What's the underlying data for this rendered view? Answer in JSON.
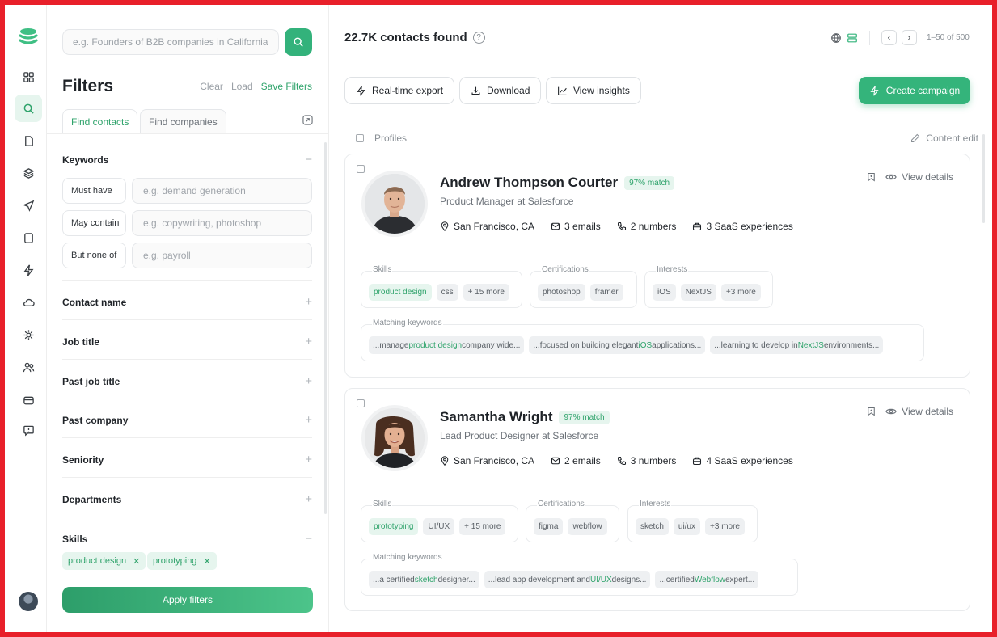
{
  "search": {
    "placeholder": "e.g. Founders of B2B companies in California"
  },
  "filters": {
    "title": "Filters",
    "clear": "Clear",
    "load": "Load",
    "save": "Save Filters",
    "tabs": [
      "Find contacts",
      "Find companies"
    ],
    "keywords": {
      "title": "Keywords",
      "rows": [
        {
          "label": "Must have",
          "placeholder": "e.g. demand generation"
        },
        {
          "label": "May contain",
          "placeholder": "e.g. copywriting, photoshop"
        },
        {
          "label": "But none of",
          "placeholder": "e.g. payroll"
        }
      ]
    },
    "sections": [
      "Contact name",
      "Job title",
      "Past job title",
      "Past company",
      "Seniority",
      "Departments"
    ],
    "skills": {
      "title": "Skills",
      "chips": [
        "product design",
        "prototyping"
      ]
    },
    "apply": "Apply filters"
  },
  "results": {
    "found": "22.7K contacts found",
    "help": "?",
    "pager": "1–50 of 500",
    "actions": [
      "Real-time export",
      "Download",
      "View insights"
    ],
    "campaign": "Create campaign",
    "profiles_label": "Profiles",
    "content_edit": "Content edit",
    "view_details": "View details"
  },
  "contacts": [
    {
      "name": "Andrew Thompson Courter",
      "match": "97% match",
      "role": "Product Manager at Salesforce",
      "location": "San Francisco, CA",
      "emails": "3 emails",
      "numbers": "2 numbers",
      "saas": "3 SaaS experiences",
      "skills_label": "Skills",
      "skills": [
        "product design",
        "css",
        "+ 15 more"
      ],
      "cert_label": "Certifications",
      "certifications": [
        "photoshop",
        "framer"
      ],
      "interests_label": "Interests",
      "interests": [
        "iOS",
        "NextJS",
        "+3 more"
      ],
      "kw_label": "Matching keywords",
      "keywords": [
        {
          "pre": "...manage ",
          "hl": "product design",
          "post": " company wide..."
        },
        {
          "pre": "...focused on building elegant ",
          "hl": "iOS",
          "post": " applications..."
        },
        {
          "pre": "...learning to develop in ",
          "hl": "NextJS",
          "post": " environments..."
        }
      ]
    },
    {
      "name": "Samantha Wright",
      "match": "97% match",
      "role": "Lead Product Designer at Salesforce",
      "location": "San Francisco, CA",
      "emails": "2 emails",
      "numbers": "3 numbers",
      "saas": "4 SaaS experiences",
      "skills_label": "Skills",
      "skills": [
        "prototyping",
        "UI/UX",
        "+ 15 more"
      ],
      "cert_label": "Certifications",
      "certifications": [
        "figma",
        "webflow"
      ],
      "interests_label": "Interests",
      "interests": [
        "sketch",
        "ui/ux",
        "+3 more"
      ],
      "kw_label": "Matching keywords",
      "keywords": [
        {
          "pre": "...a certified ",
          "hl": "sketch",
          "post": " designer..."
        },
        {
          "pre": "...lead app development and ",
          "hl": "UI/UX",
          "post": " designs..."
        },
        {
          "pre": "...certified ",
          "hl": "Webflow",
          "post": " expert..."
        }
      ]
    }
  ],
  "colors": {
    "accent": "#34b47b",
    "frame": "#e8202a"
  }
}
